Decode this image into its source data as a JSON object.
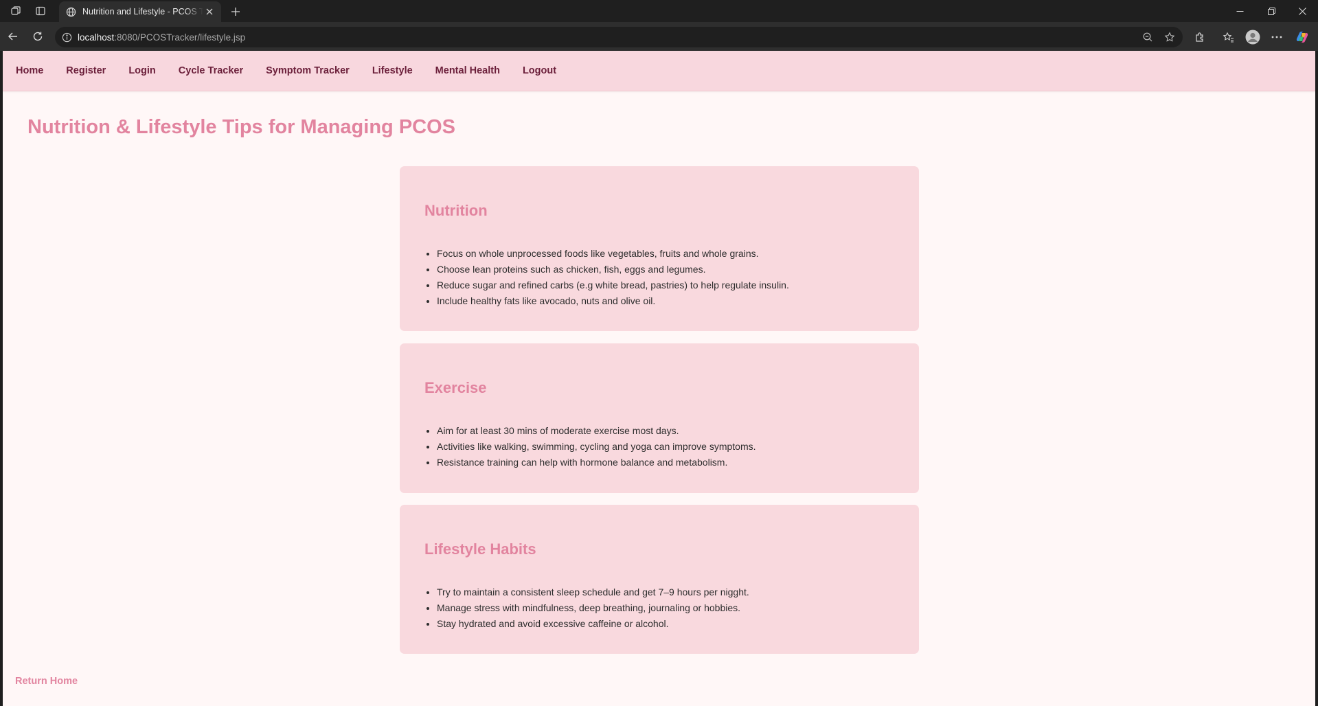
{
  "browser": {
    "tab_title": "Nutrition and Lifestyle - PCOS Tracker",
    "url_host": "localhost",
    "url_path": ":8080/PCOSTracker/lifestyle.jsp"
  },
  "nav": {
    "items": [
      "Home",
      "Register",
      "Login",
      "Cycle Tracker",
      "Symptom Tracker",
      "Lifestyle",
      "Mental Health",
      "Logout"
    ]
  },
  "page": {
    "title": "Nutrition & Lifestyle Tips for Managing PCOS",
    "return_link": "Return Home"
  },
  "sections": [
    {
      "heading": "Nutrition",
      "items": [
        "Focus on whole unprocessed foods like vegetables, fruits and whole grains.",
        "Choose lean proteins such as chicken, fish, eggs and legumes.",
        "Reduce sugar and refined carbs (e.g white bread, pastries) to help regulate insulin.",
        "Include healthy fats like avocado, nuts and olive oil."
      ]
    },
    {
      "heading": "Exercise",
      "items": [
        "Aim for at least 30 mins of moderate exercise most days.",
        "Activities like walking, swimming, cycling and yoga can improve symptoms.",
        "Resistance training can help with hormone balance and metabolism."
      ]
    },
    {
      "heading": "Lifestyle Habits",
      "items": [
        "Try to maintain a consistent sleep schedule and get 7–9 hours per nigght.",
        "Manage stress with mindfulness, deep breathing, journaling or hobbies.",
        "Stay hydrated and avoid excessive caffeine or alcohol."
      ]
    }
  ],
  "icons": {
    "workspaces": "workspaces-icon",
    "tab_actions": "tab-actions-icon",
    "globe": "globe-icon",
    "close": "close-icon",
    "new_tab": "plus-icon",
    "back": "back-arrow-icon",
    "refresh": "refresh-icon",
    "info": "info-icon",
    "zoom": "zoom-out-icon",
    "favorite": "star-icon",
    "extensions": "puzzle-icon",
    "favorites": "favorites-icon",
    "profile": "profile-icon",
    "more": "more-icon",
    "copilot": "copilot-icon"
  },
  "colors": {
    "accent": "#e2849f",
    "nav_bg": "#f8d7de",
    "nav_text": "#6b1f3a",
    "card_bg": "#f9d9de",
    "page_bg": "#fff7f7"
  }
}
